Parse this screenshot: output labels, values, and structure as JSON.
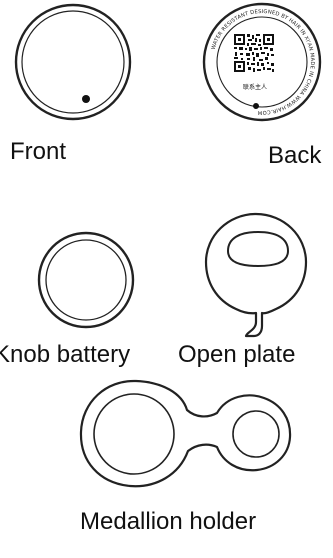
{
  "labels": {
    "front": "Front",
    "back": "Back",
    "knob_battery": "Knob battery",
    "open_plate": "Open plate",
    "medallion_holder": "Medallion holder"
  },
  "back_medallion": {
    "ring_text": "WATER RESISTANT DESIGNED BY HAIR IN XI'AN MADE IN CHINA WWW.HAIR.COM",
    "caption": "联系主人"
  },
  "colors": {
    "stroke": "#222222",
    "text": "#111111",
    "background": "#ffffff"
  }
}
